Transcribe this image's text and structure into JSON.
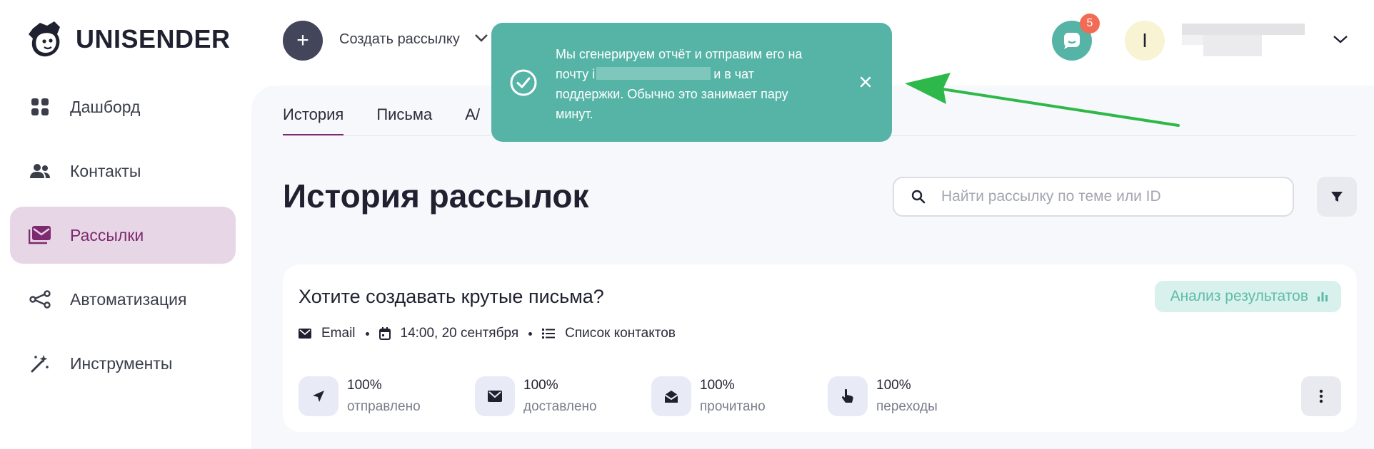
{
  "brand": {
    "name": "UNISENDER"
  },
  "sidebar": {
    "items": [
      {
        "label": "Дашборд",
        "icon": "dashboard-icon"
      },
      {
        "label": "Контакты",
        "icon": "contacts-icon"
      },
      {
        "label": "Рассылки",
        "icon": "mail-icon",
        "active": true
      },
      {
        "label": "Автоматизация",
        "icon": "automation-icon"
      },
      {
        "label": "Инструменты",
        "icon": "magic-wand-icon"
      }
    ]
  },
  "topbar": {
    "create_label": "Создать рассылку",
    "chat_badge": "5",
    "avatar_letter": "I"
  },
  "tabs": [
    {
      "label": "История",
      "active": true
    },
    {
      "label": "Письма"
    },
    {
      "label": "A/"
    }
  ],
  "page": {
    "title": "История рассылок",
    "search_placeholder": "Найти рассылку по теме или ID"
  },
  "campaign": {
    "title": "Хотите создавать крутые письма?",
    "analyze_label": "Анализ результатов",
    "channel": "Email",
    "datetime": "14:00, 20 сентября",
    "list": "Список контактов",
    "stats": [
      {
        "value": "100%",
        "label": "отправлено",
        "icon": "send-icon"
      },
      {
        "value": "100%",
        "label": "доставлено",
        "icon": "envelope-icon"
      },
      {
        "value": "100%",
        "label": "прочитано",
        "icon": "open-envelope-icon"
      },
      {
        "value": "100%",
        "label": "переходы",
        "icon": "pointer-icon"
      }
    ]
  },
  "toast": {
    "line1": "Мы сгенерируем отчёт и отправим его на",
    "line2_pre": "почту i",
    "line2_post": "и в чат",
    "line3": "поддержки. Обычно это занимает пару",
    "line4": "минут."
  },
  "colors": {
    "accent": "#7d2a6e",
    "active_bg": "#e7d6e5",
    "toast": "#56b4a7",
    "arrow": "#2eb84a"
  }
}
